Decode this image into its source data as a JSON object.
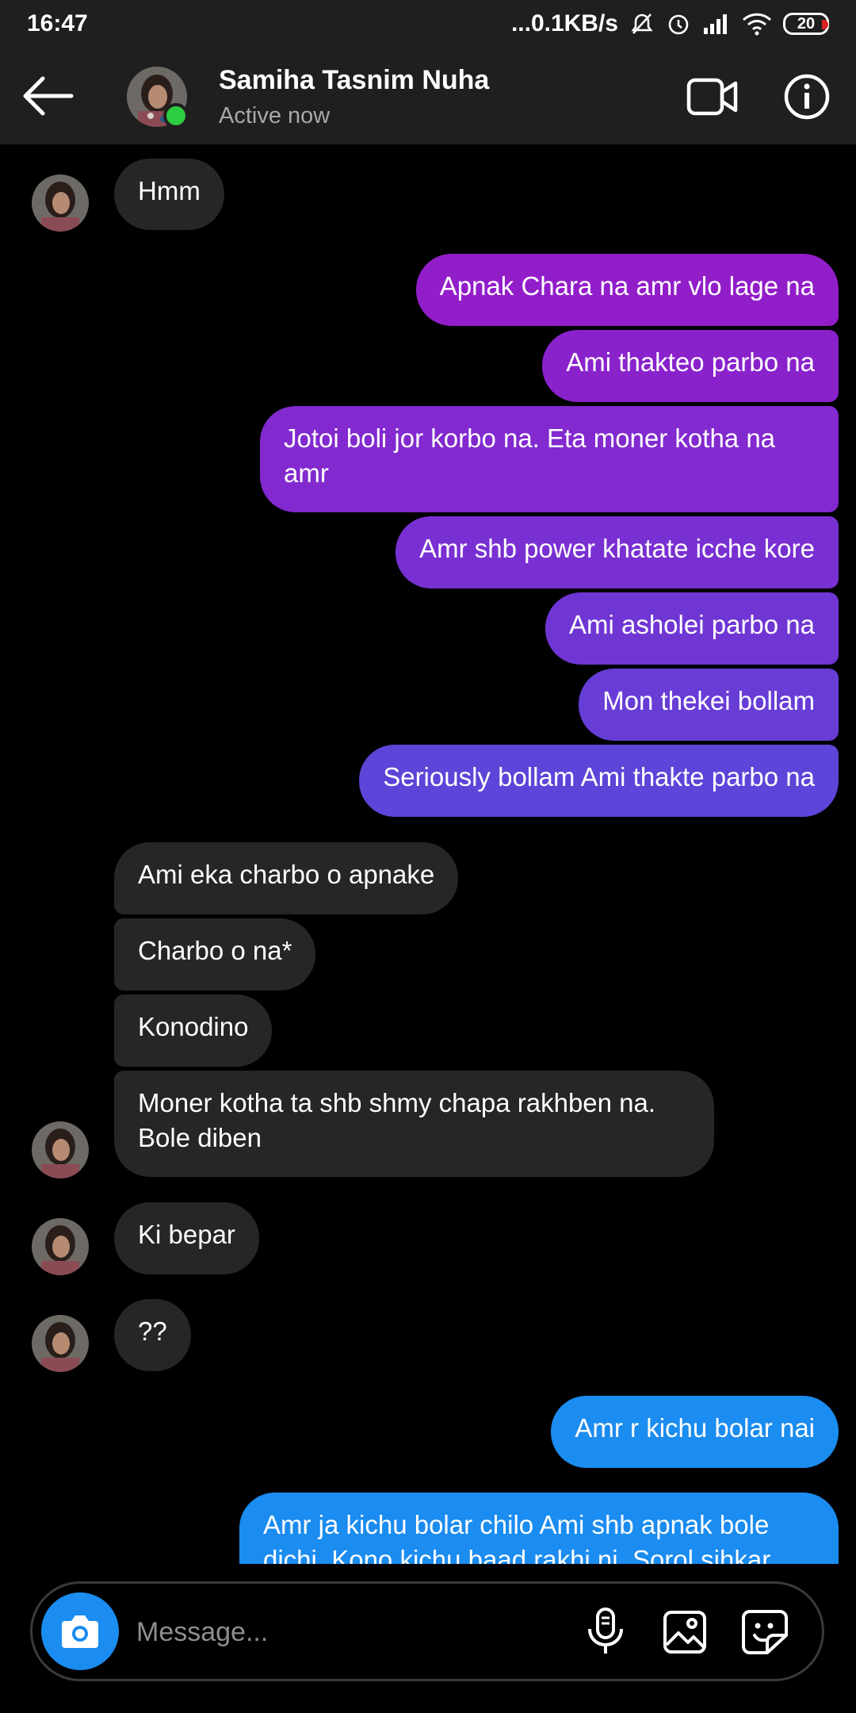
{
  "status_bar": {
    "time": "16:47",
    "network_speed": "...0.1KB/s",
    "battery": "20",
    "icons": [
      "bell-muted-icon",
      "alarm-icon",
      "signal-icon",
      "wifi-icon",
      "battery-icon"
    ]
  },
  "header": {
    "contact_name": "Samiha Tasnim Nuha",
    "status": "Active now",
    "icons": [
      "back-arrow-icon",
      "video-call-icon",
      "info-icon"
    ]
  },
  "messages": [
    {
      "from": "them",
      "text": "Hmm"
    },
    {
      "from": "me",
      "text": "Apnak Chara na amr vlo lage na"
    },
    {
      "from": "me",
      "text": "Ami thakteo parbo na"
    },
    {
      "from": "me",
      "text": "Jotoi boli jor korbo na. Eta moner kotha na amr"
    },
    {
      "from": "me",
      "text": "Amr shb power khatate icche kore"
    },
    {
      "from": "me",
      "text": "Ami asholei parbo na"
    },
    {
      "from": "me",
      "text": "Mon thekei bollam"
    },
    {
      "from": "me",
      "text": "Seriously bollam Ami thakte parbo na"
    },
    {
      "from": "them",
      "text": "Ami eka charbo o apnake"
    },
    {
      "from": "them",
      "text": "Charbo o na*"
    },
    {
      "from": "them",
      "text": "Konodino"
    },
    {
      "from": "them",
      "text": "Moner kotha ta shb shmy chapa rakhben na. Bole diben"
    },
    {
      "from": "them",
      "text": "Ki bepar"
    },
    {
      "from": "them",
      "text": "??"
    },
    {
      "from": "me",
      "text": "Amr r kichu bolar nai"
    },
    {
      "from": "me",
      "text": "Amr ja kichu bolar chilo Ami shb apnak bole dichi. Kono kichu baad rakhi ni. Sorol sihkar"
    }
  ],
  "composer": {
    "placeholder": "Message...",
    "icons": [
      "camera-icon",
      "microphone-icon",
      "gallery-icon",
      "sticker-icon"
    ]
  },
  "colors": {
    "gradient_top": "#9c1fc8",
    "gradient_mid": "#7b3ad6",
    "gradient_bottom": "#5b47d8",
    "blue_bubble": "#1b8cf0",
    "incoming_bubble": "#262626",
    "online": "#2ecc40"
  }
}
